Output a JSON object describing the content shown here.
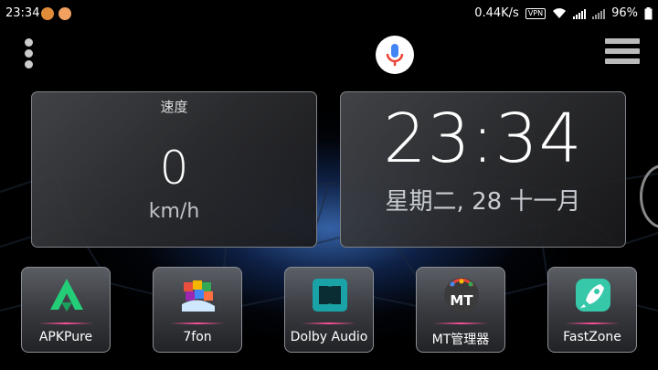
{
  "status_bar": {
    "time": "23:34",
    "net_speed": "0.44K/s",
    "vpn": "VPN",
    "battery": "96%"
  },
  "voice_search": {
    "icon": "microphone-icon"
  },
  "speed_widget": {
    "title": "速度",
    "value": "0",
    "unit": "km/h"
  },
  "clock_widget": {
    "time": "23:34",
    "date": "星期二, 28 十一月"
  },
  "apps": [
    {
      "label": "APKPure",
      "icon": "apkpure-icon",
      "color": "#24cd77"
    },
    {
      "label": "7fon",
      "icon": "7fon-icon",
      "color": "#e84f3d"
    },
    {
      "label": "Dolby Audio",
      "icon": "dolby-icon",
      "color": "#1aa3a6"
    },
    {
      "label": "MT管理器",
      "icon": "mt-manager-icon",
      "color": "#3b3b3b"
    },
    {
      "label": "FastZone",
      "icon": "rocket-icon",
      "color": "#37c7a9"
    }
  ]
}
